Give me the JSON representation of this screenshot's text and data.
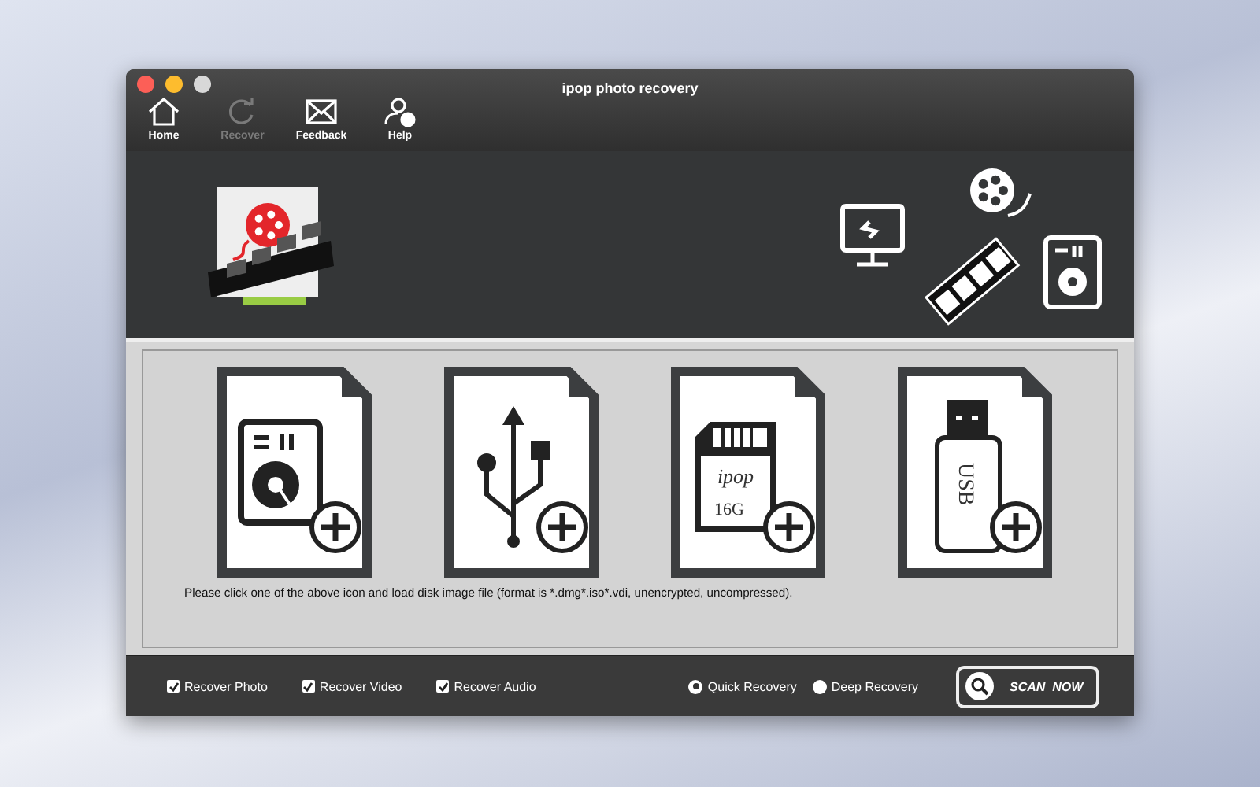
{
  "window": {
    "title": "ipop photo recovery"
  },
  "toolbar": [
    {
      "kind": "home",
      "label": "Home",
      "disabled": false
    },
    {
      "kind": "recover",
      "label": "Recover",
      "disabled": true
    },
    {
      "kind": "feedback",
      "label": "Feedback",
      "disabled": false
    },
    {
      "kind": "help",
      "label": "Help",
      "disabled": false
    }
  ],
  "devices": [
    {
      "kind": "hdd"
    },
    {
      "kind": "usb"
    },
    {
      "kind": "sdcard",
      "brand": "ipop",
      "capacity": "16G"
    },
    {
      "kind": "flash",
      "label": "USB"
    }
  ],
  "instruction": "Please click one of the above icon and load disk image file  (format is *.dmg*.iso*.vdi, unencrypted, uncompressed).",
  "options": [
    {
      "label": "Recover Photo",
      "checked": true
    },
    {
      "label": "Recover Video",
      "checked": true
    },
    {
      "label": "Recover Audio",
      "checked": true
    }
  ],
  "modes": [
    {
      "label": "Quick Recovery",
      "selected": true
    },
    {
      "label": "Deep Recovery",
      "selected": false
    }
  ],
  "scan_button": "SCAN  NOW"
}
